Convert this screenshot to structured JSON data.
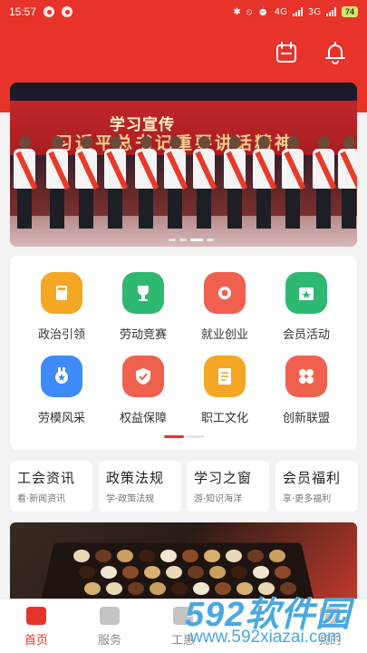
{
  "status_bar": {
    "time": "15:57",
    "battery": "74",
    "signal_1": "4G",
    "signal_2": "3G"
  },
  "banner": {
    "title": "学习宣传",
    "subtitle": "习近平总书记重要讲话精神",
    "badge": ""
  },
  "grid": [
    {
      "label": "政治引领",
      "icon": "book-icon",
      "color": "#f5a623"
    },
    {
      "label": "劳动竞赛",
      "icon": "trophy-icon",
      "color": "#2eb872"
    },
    {
      "label": "就业创业",
      "icon": "search-icon",
      "color": "#f0604f"
    },
    {
      "label": "会员活动",
      "icon": "calendar-star-icon",
      "color": "#2eb872"
    },
    {
      "label": "劳模风采",
      "icon": "medal-icon",
      "color": "#3d8bfd"
    },
    {
      "label": "权益保障",
      "icon": "shield-check-icon",
      "color": "#f0604f"
    },
    {
      "label": "职工文化",
      "icon": "document-icon",
      "color": "#f5a623"
    },
    {
      "label": "创新联盟",
      "icon": "four-petal-icon",
      "color": "#f0604f"
    }
  ],
  "quick": [
    {
      "title": "工会资讯",
      "sub": "看·新闻资讯"
    },
    {
      "title": "政策法规",
      "sub": "学·政策法规"
    },
    {
      "title": "学习之窗",
      "sub": "游·知识海洋"
    },
    {
      "title": "会员福利",
      "sub": "享·更多福利"
    }
  ],
  "tabs": [
    {
      "label": "首页",
      "active": true
    },
    {
      "label": "服务",
      "active": false
    },
    {
      "label": "工惠",
      "active": false
    },
    {
      "label": "我的",
      "active": false
    }
  ],
  "watermark": {
    "brand": "592软件园",
    "url": "www.592xiazai.com"
  },
  "colors": {
    "primary": "#e8332a",
    "background": "#f2f2f2"
  }
}
